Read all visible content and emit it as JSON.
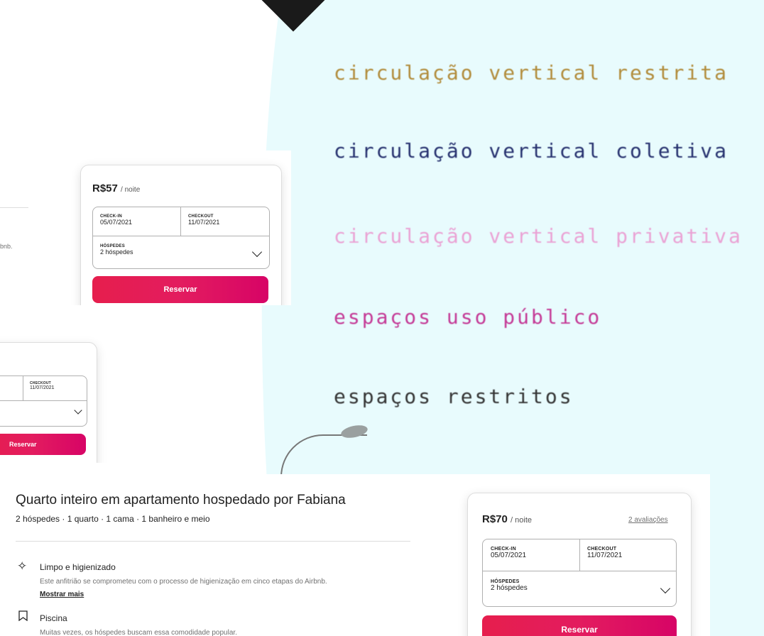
{
  "background": {
    "colors": {
      "cyan": "#e8fbfd",
      "brand": "#e61e4d"
    },
    "pixel_lines": [
      "circulação vertical restrita",
      "circulação vertical coletiva",
      "circulação vertical privativa",
      "espaços uso público",
      "espaços restritos"
    ]
  },
  "listing_top": {
    "price": "R$57",
    "per_night": "/ noite",
    "checkin_label": "CHECK-IN",
    "checkin_value": "05/07/2021",
    "checkout_label": "CHECKOUT",
    "checkout_value": "11/07/2021",
    "guests_label": "HÓSPEDES",
    "guests_value": "2 hóspedes",
    "reserve_label": "Reservar",
    "left_fragment": "bnb."
  },
  "listing_middle": {
    "checkout_label": "CHECKOUT",
    "checkout_value": "11/07/2021",
    "reserve_label": "Reservar"
  },
  "listing_main": {
    "title": "Quarto inteiro em apartamento hospedado por Fabiana",
    "subtitle": "2 hóspedes · 1 quarto · 1 cama · 1 banheiro e meio",
    "amenities": [
      {
        "icon": "sparkle-icon",
        "title": "Limpo e higienizado",
        "desc": "Este anfitrião se comprometeu com o processo de higienização em cinco etapas do Airbnb.",
        "more": "Mostrar mais"
      },
      {
        "icon": "bookmark-icon",
        "title": "Piscina",
        "desc": "Muitas vezes, os hóspedes buscam essa comodidade popular."
      }
    ],
    "price": "R$70",
    "per_night": "/ noite",
    "reviews": "2 avaliações",
    "checkin_label": "CHECK-IN",
    "checkin_value": "05/07/2021",
    "checkout_label": "CHECKOUT",
    "checkout_value": "11/07/2021",
    "guests_label": "HÓSPEDES",
    "guests_value": "2 hóspedes",
    "reserve_label": "Reservar"
  }
}
